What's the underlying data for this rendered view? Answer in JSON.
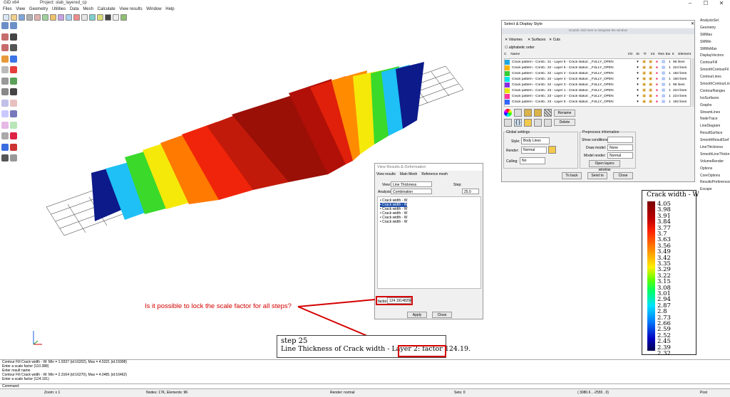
{
  "app": {
    "title": "GiD x64",
    "project": "Project: slab_layered_cp"
  },
  "menu": [
    "Files",
    "View",
    "Geometry",
    "Utilities",
    "Data",
    "Mesh",
    "Calculate",
    "View results",
    "Window",
    "Help"
  ],
  "right_panel": [
    "AnalysisSel",
    "Geometry",
    "SMMax",
    "SMMin",
    "SMMxMax",
    "DisplayVectors",
    "ContourFill",
    "SmoothContourFil",
    "ContourLines",
    "SmoothContourLin",
    "ContourRanges",
    "IsoSurfaces",
    "Graphs",
    "StreamLines",
    "NodeTrace",
    "LineDiagram",
    "ResultSurface",
    "SmoothResultSurf",
    "LineThickness",
    "SmoothLineThickn",
    "VolumeRender",
    "Options",
    "CoreOptions",
    "ResultsPreferences",
    "Escape"
  ],
  "select_display": {
    "title": "Select & Display Style",
    "hint": "Double click here to integrate the window",
    "filters": [
      "Volumes",
      "Surfaces",
      "Cuts"
    ],
    "alphabetic": "alphabetic order",
    "columns": [
      "C",
      "Name",
      "I/O",
      "St",
      "Tr",
      "Int",
      "Res",
      "Ew",
      "It",
      "Element"
    ],
    "rows": [
      {
        "color": "#1fa8e0",
        "name": "Crack pattern - Comb.: 21 - Layer 5 - Crack status: _FULLY_OPEN",
        "n": "1",
        "elem": "96 lines"
      },
      {
        "color": "#ffb300",
        "name": "Crack pattern - Comb.: 22 - Layer 5 - Crack status: _FULLY_OPEN",
        "n": "1",
        "elem": "224 lines"
      },
      {
        "color": "#33cc33",
        "name": "Crack pattern - Comb.: 22 - Layer 2 - Crack status: _FULLY_OPEN",
        "n": "1",
        "elem": "192 lines"
      },
      {
        "color": "#00e6e6",
        "name": "Crack pattern - Comb.: 22 - Layer 4 - Crack status: _FULLY_OPEN",
        "n": "1",
        "elem": "160 lines"
      },
      {
        "color": "#8a2be2",
        "name": "Crack pattern - Comb.: 22 - Layer 3 - Crack status: _FULLY_OPEN",
        "n": "1",
        "elem": "96 lines"
      },
      {
        "color": "#e6e600",
        "name": "Crack pattern - Comb.: 23 - Layer 1 - Crack status: _FULLY_OPEN",
        "n": "1",
        "elem": "224 lines"
      },
      {
        "color": "#ff3399",
        "name": "Crack pattern - Comb.: 23 - Layer 2 - Crack status: _FULLY_OPEN",
        "n": "1",
        "elem": "224 lines"
      },
      {
        "color": "#3366ff",
        "name": "Crack pattern - Comb.: 23 - Layer 5 - Crack status: _FULLY_OPEN",
        "n": "1",
        "elem": "192 lines"
      }
    ],
    "rename": "Rename",
    "delete": "Delete",
    "global_settings": "Global settings",
    "style_label": "Style:",
    "style_value": "Body Lines",
    "render_label": "Render:",
    "render_value": "Normal",
    "culling_label": "Culling:",
    "culling_value": "No",
    "preprocess_label": "Preprocess information",
    "show_conditions_label": "Show conditions:",
    "show_conditions_value": "",
    "draw_model_label": "Draw model:",
    "draw_model_value": "None",
    "model_render_label": "Model render:",
    "model_render_value": "Normal",
    "open_layers": "Open layers window",
    "to_back": "To back",
    "send_to": "Send to",
    "close": "Close"
  },
  "view_results": {
    "title": "View Results & Deformation",
    "tabs": [
      "View results",
      "Main Mesh",
      "Reference mesh"
    ],
    "view_label": "View:",
    "view_value": "Line Thickness",
    "analysis_label": "Analysis:",
    "analysis_value": "Combination",
    "step_label": "Step:",
    "step_value": "25.0",
    "items": [
      "Crack width - W",
      "Crack width - W",
      "Crack width - W",
      "Crack width - W",
      "Crack width - W",
      "Crack width - W"
    ],
    "factor_label": "factor:",
    "factor_value": "124.19148254",
    "apply": "Apply",
    "close": "Close"
  },
  "legend": {
    "title": "Crack width - W",
    "values": [
      "4.05",
      "3.98",
      "3.91",
      "3.84",
      "3.77",
      "3.7",
      "3.63",
      "3.56",
      "3.49",
      "3.42",
      "3.35",
      "3.29",
      "3.22",
      "3.15",
      "3.08",
      "3.01",
      "2.94",
      "2.87",
      "2.8",
      "2.73",
      "2.66",
      "2.59",
      "2.52",
      "2.45",
      "2.39",
      "2.32"
    ]
  },
  "step_box": {
    "line1": "step 25",
    "line2": "Line Thickness of Crack width - Layer 2: factor 124.19."
  },
  "annotation": {
    "question": "Is it possible to lock the scale factor for all steps?",
    "color": "#d40000"
  },
  "command_log": [
    "Contour Fill Crack width - W: Min = 1.9337 (id:16202), Max = 4.5321 (id:15998)",
    "Enter a scale factor (110.388)",
    "Enter result name",
    "Contour Fill Crack width - W: Min = 2.3164 (id:16270), Max = 4.0481 (id:16462)",
    "Enter a scale factor (124.191)"
  ],
  "command_label": "Command:",
  "status": {
    "zoom": "Zoom: x 1",
    "nodes": "Nodes: 17K, Elements: 9K",
    "render": "Render: normal",
    "sets": "Sets: 0",
    "coords": "( 3080.6 , -2555 , 0)",
    "mode": "Post"
  }
}
